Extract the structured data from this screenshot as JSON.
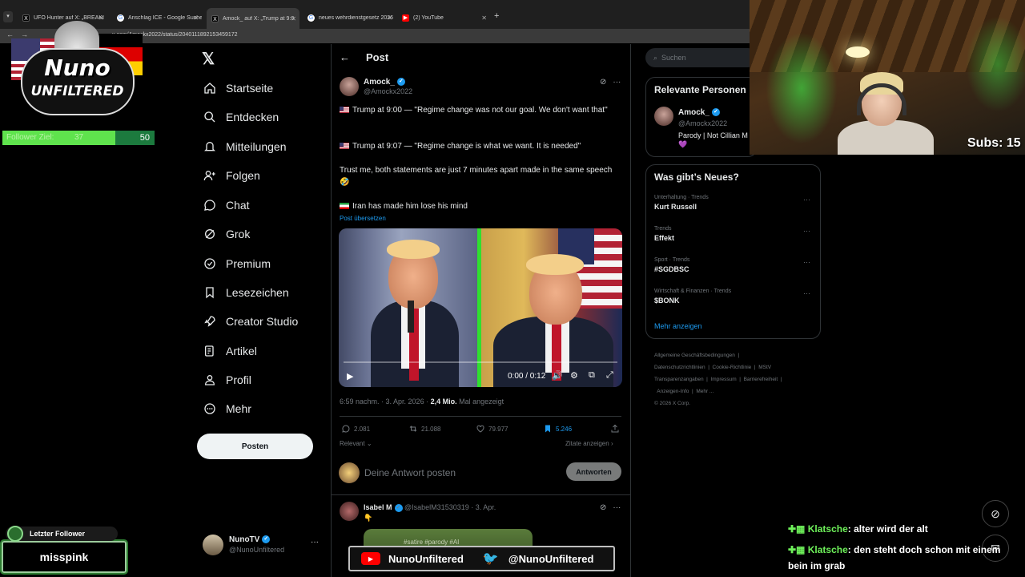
{
  "browser": {
    "tabs": [
      {
        "title": "UFO Hunter auf X: „BREAKI",
        "favicon": "x-icon"
      },
      {
        "title": "Anschlag ICE - Google Suche",
        "favicon": "google-icon"
      },
      {
        "title": "Amock_ auf X: „Trump at 9:0",
        "favicon": "x-icon"
      },
      {
        "title": "neues wehrdienstgesetz 2026",
        "favicon": "google-icon"
      },
      {
        "title": "(2) YouTube",
        "favicon": "youtube-icon"
      }
    ],
    "new_tab": "+",
    "address": "x.com/Amockx2022/status/2040111892153459172"
  },
  "nav": {
    "items": [
      {
        "label": "Startseite",
        "icon": "home-icon"
      },
      {
        "label": "Entdecken",
        "icon": "search-icon"
      },
      {
        "label": "Mitteilungen",
        "icon": "bell-icon"
      },
      {
        "label": "Folgen",
        "icon": "follow-icon"
      },
      {
        "label": "Chat",
        "icon": "chat-icon"
      },
      {
        "label": "Grok",
        "icon": "grok-icon"
      },
      {
        "label": "Premium",
        "icon": "premium-icon"
      },
      {
        "label": "Lesezeichen",
        "icon": "bookmark-icon"
      },
      {
        "label": "Creator Studio",
        "icon": "rocket-icon"
      },
      {
        "label": "Artikel",
        "icon": "article-icon"
      },
      {
        "label": "Profil",
        "icon": "profile-icon"
      },
      {
        "label": "Mehr",
        "icon": "more-icon"
      }
    ],
    "post_button": "Posten",
    "account": {
      "name": "NunoTV",
      "handle": "@NunoUnfiltered",
      "more": "···"
    }
  },
  "post": {
    "header": "Post",
    "back": "←",
    "author": {
      "name": "Amock_",
      "handle": "@Amockx2022"
    },
    "lines": [
      "Trump at 9:00 — \"Regime change was not our goal. We don't want that\"",
      "Trump at 9:07 — \"Regime change is what we want. It is needed\"",
      "Trust me, both statements are just 7 minutes apart made in the same speech 🤣",
      "Iran has made him lose his mind"
    ],
    "translate": "Post übersetzen",
    "video": {
      "time": "0:00 / 0:12",
      "progress": 0
    },
    "meta": {
      "time": "6:59 nachm. · 3. Apr. 2026 · ",
      "views": "2,4 Mio.",
      "views_label": " Mal angezeigt"
    },
    "stats": {
      "replies": "2.081",
      "reposts": "21.088",
      "likes": "79.977",
      "bookmarks": "5.246"
    },
    "relevant": "Relevant",
    "quotes": "Zitate anzeigen",
    "reply_placeholder": "Deine Antwort posten",
    "reply_button": "Antworten",
    "reply": {
      "name": "Isabel M",
      "handle": "@IsabelM31530319 · 3. Apr.",
      "emoji": "👇",
      "image_text": "#satire #parody #AI"
    }
  },
  "sidebar": {
    "search_placeholder": "Suchen",
    "relevant_title": "Relevante Personen",
    "relevant_person": {
      "name": "Amock_",
      "handle": "@Amockx2022",
      "bio": "Parody | Not Cillian M",
      "heart": "💜"
    },
    "news_title": "Was gibt’s Neues?",
    "trends": [
      {
        "category": "Unterhaltung · Trends",
        "name": "Kurt Russell"
      },
      {
        "category": "Trends",
        "name": "Effekt"
      },
      {
        "category": "Sport · Trends",
        "name": "#SGDBSC"
      },
      {
        "category": "Wirtschaft & Finanzen · Trends",
        "name": "$BONK"
      }
    ],
    "show_more": "Mehr anzeigen",
    "footer": [
      "Allgemeine Geschäftsbedingungen",
      "Datenschutzrichtlinien",
      "Cookie-Richtlinie",
      "MStV Transparenzangaben",
      "Impressum",
      "Barrierefreiheit",
      "Anzeigen-Info",
      "Mehr ...",
      "© 2026 X Corp."
    ]
  },
  "overlay": {
    "logo_line1": "Nuno",
    "logo_line2": "UNFILTERED",
    "follower_goal": {
      "label": "Follower Ziel:",
      "current": "37",
      "max": "50",
      "fraction": 0.74
    },
    "subs": "Subs: 15",
    "last_follower_label": "Letzter Follower",
    "last_follower_name": "misspink",
    "social_youtube": "NunoUnfiltered",
    "social_twitter": "@NunoUnfiltered",
    "chat": [
      {
        "user": "Klatsche",
        "message": ": alter wird der alt"
      },
      {
        "user": "Klatsche",
        "message": ": den steht doch schon mit einem bein im grab"
      }
    ]
  },
  "colors": {
    "accent": "#1d9bf0",
    "background": "#000000",
    "border": "#2f3336",
    "muted": "#71767b",
    "goal_green": "#5fe34d",
    "video_divider": "#2fe02f"
  }
}
